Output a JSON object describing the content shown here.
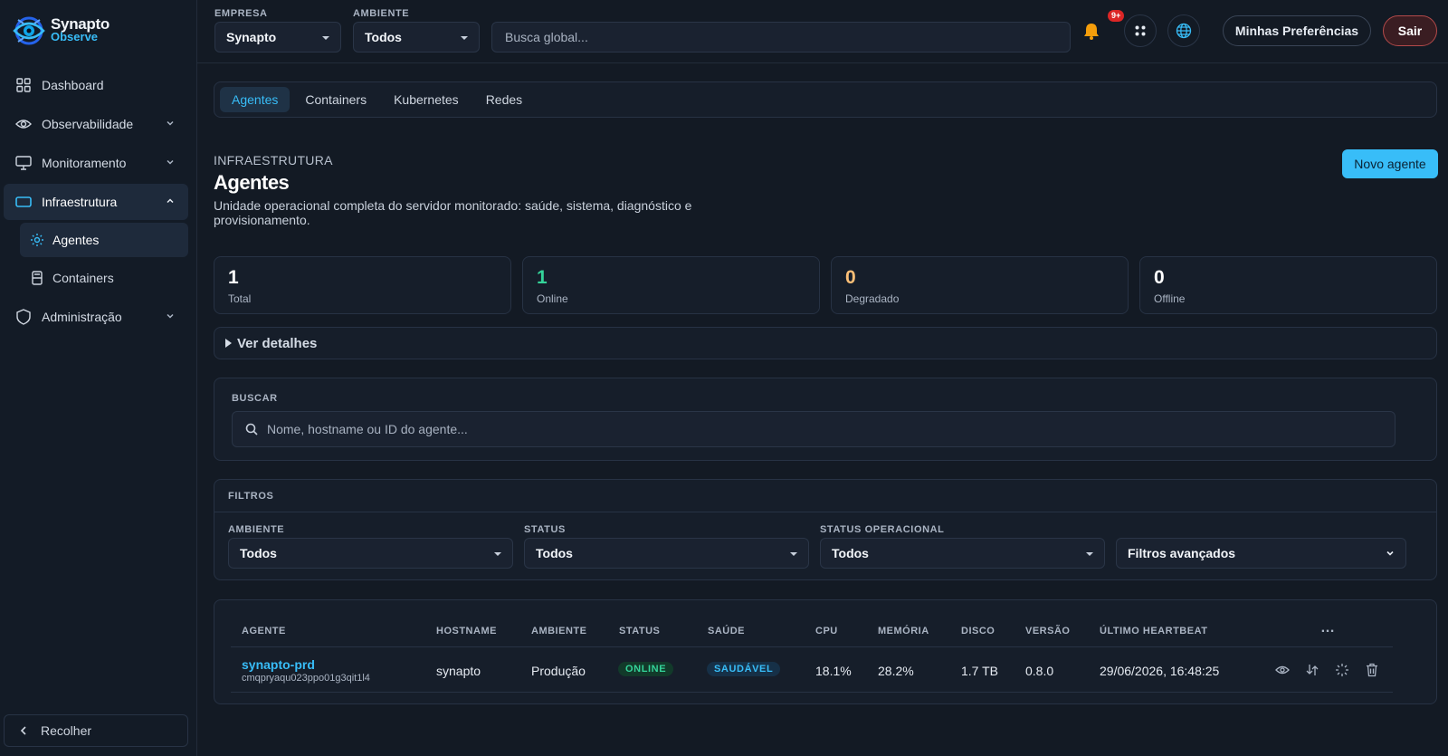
{
  "app": {
    "brand_line1": "Synapto",
    "brand_line2": "Observe"
  },
  "sidebar": {
    "items": [
      {
        "label": "Dashboard",
        "icon": "grid-icon"
      },
      {
        "label": "Observabilidade",
        "icon": "eye-icon"
      },
      {
        "label": "Monitoramento",
        "icon": "monitor-icon"
      },
      {
        "label": "Infraestrutura",
        "icon": "server-icon"
      },
      {
        "label": "Administração",
        "icon": "shield-icon"
      }
    ],
    "subitems": [
      {
        "label": "Agentes",
        "icon": "gear-icon"
      },
      {
        "label": "Containers",
        "icon": "container-icon"
      }
    ],
    "collapse_label": "Recolher"
  },
  "topbar": {
    "empresa_label": "EMPRESA",
    "empresa_value": "Synapto",
    "ambiente_label": "AMBIENTE",
    "ambiente_value": "Todos",
    "search_placeholder": "Busca global...",
    "notif_badge": "9+",
    "preferences_label": "Minhas Preferências",
    "exit_label": "Sair"
  },
  "tabs": [
    "Agentes",
    "Containers",
    "Kubernetes",
    "Redes"
  ],
  "page": {
    "kicker": "INFRAESTRUTURA",
    "title": "Agentes",
    "description": "Unidade operacional completa do servidor monitorado: saúde, sistema, diagnóstico e provisionamento.",
    "new_button": "Novo agente"
  },
  "stats": [
    {
      "value": "1",
      "label": "Total",
      "color": "#ffffff"
    },
    {
      "value": "1",
      "label": "Online",
      "color": "#34d399"
    },
    {
      "value": "0",
      "label": "Degradado",
      "color": "#fbbf77"
    },
    {
      "value": "0",
      "label": "Offline",
      "color": "#ffffff"
    }
  ],
  "details_label": "Ver detalhes",
  "search": {
    "label": "BUSCAR",
    "placeholder": "Nome, hostname ou ID do agente..."
  },
  "filters": {
    "title": "FILTROS",
    "ambiente_label": "AMBIENTE",
    "ambiente_value": "Todos",
    "status_label": "STATUS",
    "status_value": "Todos",
    "opstatus_label": "STATUS OPERACIONAL",
    "opstatus_value": "Todos",
    "advanced_label": "Filtros avançados"
  },
  "table": {
    "headers": [
      "AGENTE",
      "HOSTNAME",
      "AMBIENTE",
      "STATUS",
      "SAÚDE",
      "CPU",
      "MEMÓRIA",
      "DISCO",
      "VERSÃO",
      "ÚLTIMO HEARTBEAT"
    ],
    "more_icon": "…",
    "rows": [
      {
        "agent": "synapto-prd",
        "agent_id": "cmqpryaqu023ppo01g3qit1l4",
        "hostname": "synapto",
        "ambiente": "Produção",
        "status": "ONLINE",
        "saude": "SAUDÁVEL",
        "cpu": "18.1%",
        "memoria": "28.2%",
        "disco": "1.7 TB",
        "versao": "0.8.0",
        "heartbeat": "29/06/2026, 16:48:25"
      }
    ]
  },
  "colors": {
    "accent": "#38bdf8",
    "online": "#34d399",
    "danger": "#dc2626",
    "bg": "#131a24"
  }
}
